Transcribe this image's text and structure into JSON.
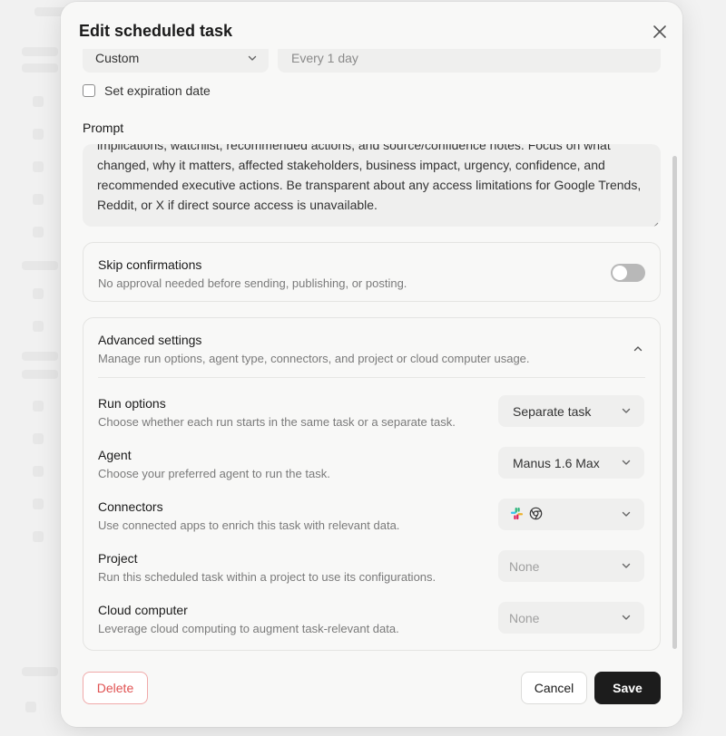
{
  "modal": {
    "title": "Edit scheduled task",
    "close_icon": "close-icon"
  },
  "schedule": {
    "repeat_value": "Custom",
    "interval_value": "Every 1 day",
    "expiration_label": "Set expiration date",
    "expiration_checked": false
  },
  "prompt": {
    "label": "Prompt",
    "text": "implications, watchlist, recommended actions, and source/confidence notes. Focus on what changed, why it matters, affected stakeholders, business impact, urgency, confidence, and recommended executive actions. Be transparent about any access limitations for Google Trends, Reddit, or X if direct source access is unavailable."
  },
  "skip_confirmations": {
    "title": "Skip confirmations",
    "description": "No approval needed before sending, publishing, or posting.",
    "enabled": false
  },
  "advanced": {
    "title": "Advanced settings",
    "description": "Manage run options, agent type, connectors, and project or cloud computer usage.",
    "expanded": true,
    "options": [
      {
        "id": "run-options",
        "title": "Run options",
        "description": "Choose whether each run starts in the same task or a separate task.",
        "value": "Separate task"
      },
      {
        "id": "agent",
        "title": "Agent",
        "description": "Choose your preferred agent to run the task.",
        "value": "Manus 1.6 Max"
      },
      {
        "id": "connectors",
        "title": "Connectors",
        "description": "Use connected apps to enrich this task with relevant data.",
        "value": "",
        "icons": [
          "slack-icon",
          "chrome-icon"
        ]
      },
      {
        "id": "project",
        "title": "Project",
        "description": "Run this scheduled task within a project to use its configurations.",
        "value": "None"
      },
      {
        "id": "cloud-computer",
        "title": "Cloud computer",
        "description": "Leverage cloud computing to augment task-relevant data.",
        "value": "None"
      }
    ]
  },
  "footer": {
    "delete_label": "Delete",
    "cancel_label": "Cancel",
    "save_label": "Save"
  },
  "colors": {
    "danger": "#e05252",
    "primary": "#1c1c1c",
    "surface": "#efefee",
    "toggle_off": "#b8b8b8"
  }
}
